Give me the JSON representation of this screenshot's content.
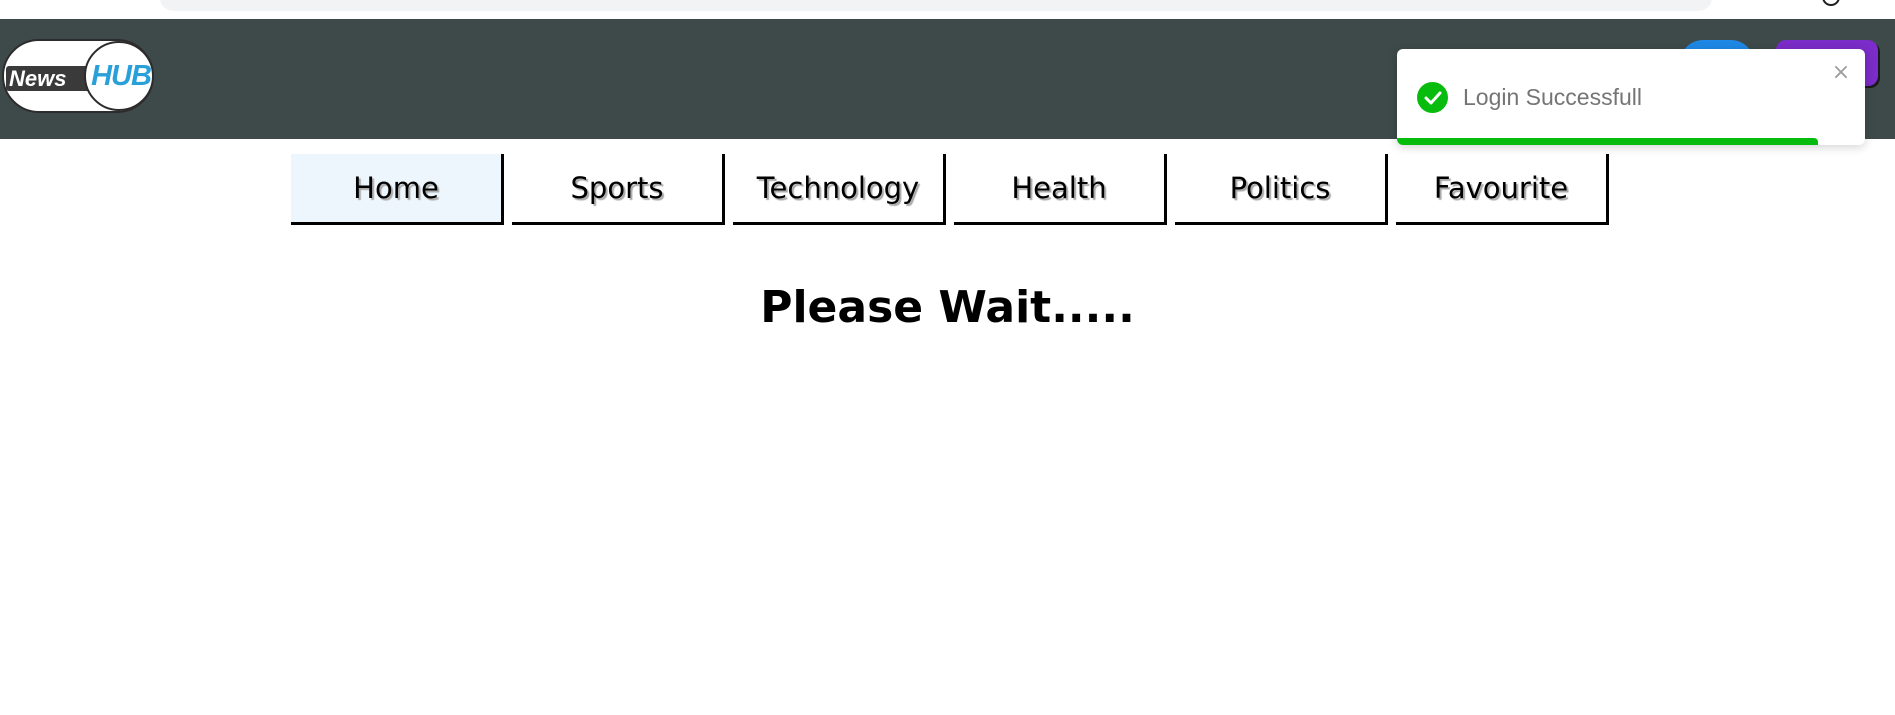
{
  "logo": {
    "part1": "News",
    "part2": "HUB"
  },
  "toast": {
    "message": "Login Successfull",
    "close_symbol": "×",
    "icon": "check-circle-icon",
    "color": "#07bc0c",
    "progress": 0.9
  },
  "nav": {
    "tabs": [
      {
        "label": "Home",
        "active": true
      },
      {
        "label": "Sports",
        "active": false
      },
      {
        "label": "Technology",
        "active": false
      },
      {
        "label": "Health",
        "active": false
      },
      {
        "label": "Politics",
        "active": false
      },
      {
        "label": "Favourite",
        "active": false
      }
    ]
  },
  "main": {
    "loading_text": "Please Wait....."
  },
  "colors": {
    "header_bg": "#3e4a4a",
    "logo_hub": "#2aa0d8",
    "active_tab_bg": "#eef6fd",
    "header_button_blue": "#1e88e5",
    "header_button_purple": "#7b2cc9"
  }
}
